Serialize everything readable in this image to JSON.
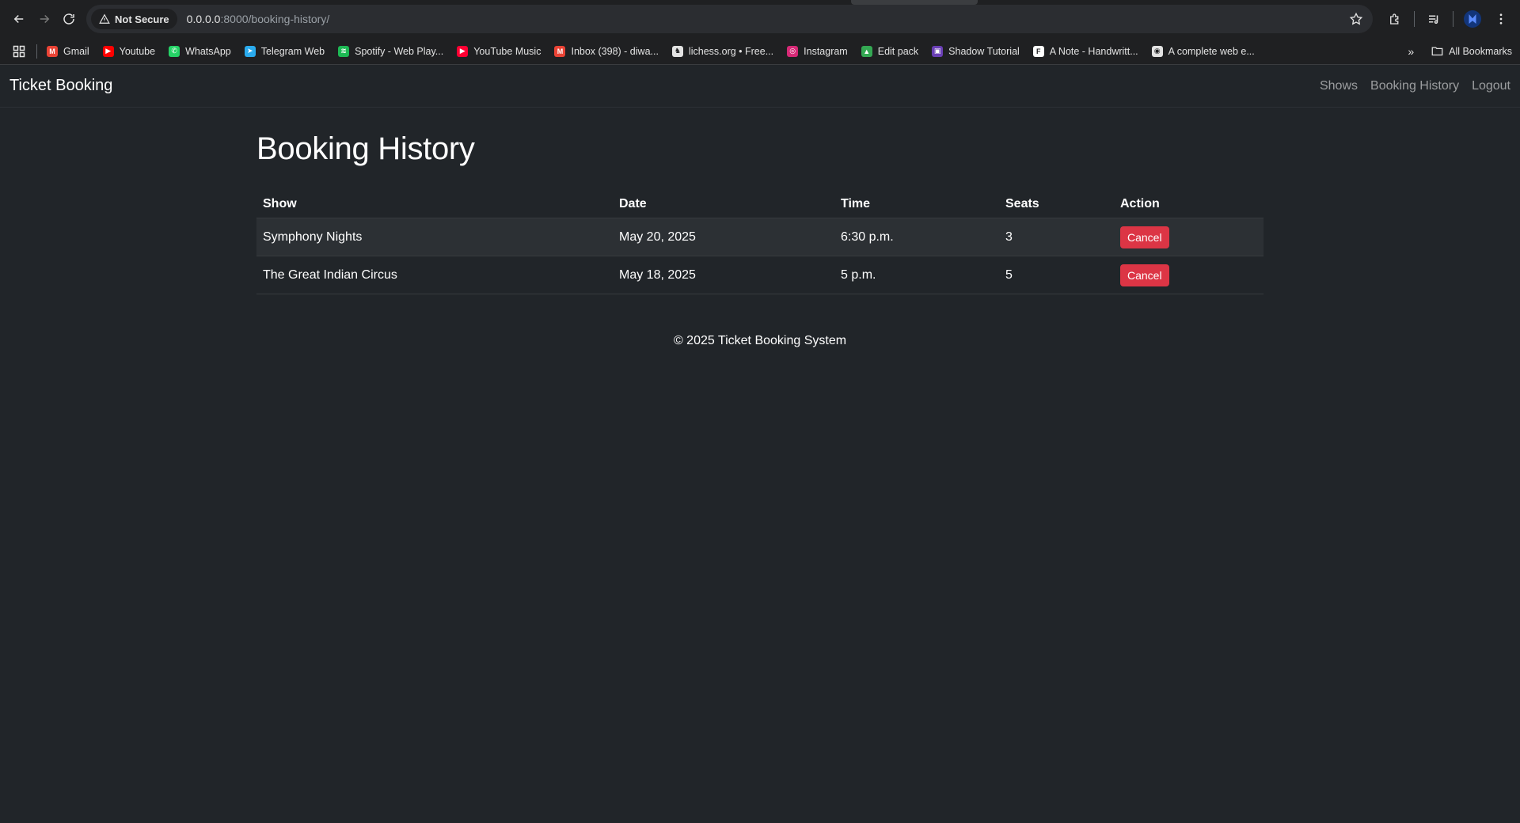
{
  "browser": {
    "security_label": "Not Secure",
    "url_host": "0.0.0.0",
    "url_rest": ":8000/booking-history/",
    "bookmarks": [
      {
        "label": "Gmail",
        "icon": "gmail-icon",
        "color": "#ea4335",
        "glyph": "M"
      },
      {
        "label": "Youtube",
        "icon": "youtube-icon",
        "color": "#ff0000",
        "glyph": "▶"
      },
      {
        "label": "WhatsApp",
        "icon": "whatsapp-icon",
        "color": "#25d366",
        "glyph": "✆"
      },
      {
        "label": "Telegram Web",
        "icon": "telegram-icon",
        "color": "#2aabee",
        "glyph": "➤"
      },
      {
        "label": "Spotify - Web Play...",
        "icon": "spotify-icon",
        "color": "#1db954",
        "glyph": "≋"
      },
      {
        "label": "YouTube Music",
        "icon": "youtube-music-icon",
        "color": "#ff0033",
        "glyph": "▶"
      },
      {
        "label": "Inbox (398) - diwa...",
        "icon": "gmail-icon",
        "color": "#ea4335",
        "glyph": "M"
      },
      {
        "label": "lichess.org • Free...",
        "icon": "lichess-icon",
        "color": "#e3e3e3",
        "glyph": "♞"
      },
      {
        "label": "Instagram",
        "icon": "instagram-icon",
        "color": "#d62976",
        "glyph": "◎"
      },
      {
        "label": "Edit pack",
        "icon": "google-drive-icon",
        "color": "#34a853",
        "glyph": "▲"
      },
      {
        "label": "Shadow Tutorial",
        "icon": "shadow-tutorial-icon",
        "color": "#6a3fb5",
        "glyph": "▣"
      },
      {
        "label": "A Note - Handwritt...",
        "icon": "note-icon",
        "color": "#ffffff",
        "glyph": "F"
      },
      {
        "label": "A complete web e...",
        "icon": "web-icon",
        "color": "#e3e3e3",
        "glyph": "◉"
      }
    ],
    "all_bookmarks_label": "All Bookmarks",
    "more_bookmarks_label": "»"
  },
  "navbar": {
    "brand": "Ticket Booking",
    "links": [
      "Shows",
      "Booking History",
      "Logout"
    ]
  },
  "page": {
    "title": "Booking History",
    "columns": [
      "Show",
      "Date",
      "Time",
      "Seats",
      "Action"
    ],
    "rows": [
      {
        "show": "Symphony Nights",
        "date": "May 20, 2025",
        "time": "6:30 p.m.",
        "seats": "3",
        "action": "Cancel"
      },
      {
        "show": "The Great Indian Circus",
        "date": "May 18, 2025",
        "time": "5 p.m.",
        "seats": "5",
        "action": "Cancel"
      }
    ],
    "footer": "© 2025 Ticket Booking System"
  },
  "colors": {
    "background": "#212529",
    "danger": "#dc3545",
    "striped_row": "#2c3034"
  }
}
